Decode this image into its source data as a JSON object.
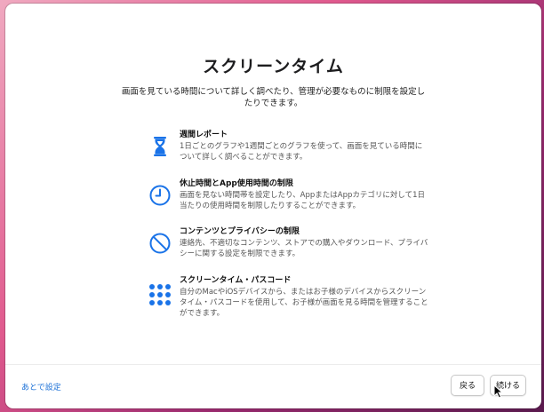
{
  "page": {
    "title": "スクリーンタイム",
    "subtitle": "画面を見ている時間について詳しく調べたり、管理が必要なものに制限を設定したりできます。"
  },
  "features": [
    {
      "icon": "hourglass-icon",
      "title": "週間レポート",
      "description": "1日ごとのグラフや1週間ごとのグラフを使って、画面を見ている時間について詳しく調べることができます。"
    },
    {
      "icon": "clock-icon",
      "title": "休止時間とApp使用時間の制限",
      "description": "画面を見ない時間帯を設定したり、AppまたはAppカテゴリに対して1日当たりの使用時間を制限したりすることができます。"
    },
    {
      "icon": "prohibited-icon",
      "title": "コンテンツとプライバシーの制限",
      "description": "連絡先、不適切なコンテンツ、ストアでの購入やダウンロード、プライバシーに関する設定を制限できます。"
    },
    {
      "icon": "keypad-icon",
      "title": "スクリーンタイム・パスコード",
      "description": "自分のMacやiOSデバイスから、またはお子様のデバイスからスクリーンタイム・パスコードを使用して、お子様が画面を見る時間を管理することができます。"
    }
  ],
  "footer": {
    "later_label": "あとで設定",
    "back_label": "戻る",
    "continue_label": "続ける"
  },
  "colors": {
    "accent": "#1a6fd6",
    "icon": "#1a73e8"
  }
}
